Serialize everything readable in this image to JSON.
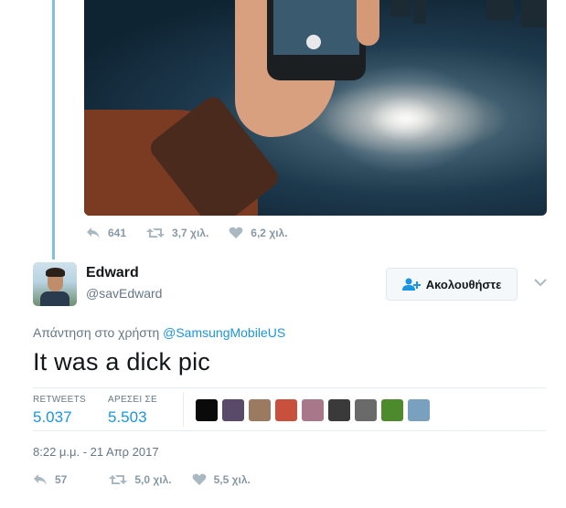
{
  "media": {
    "description_icon": "photo-hand-holding-phone"
  },
  "quoted_actions": {
    "replies": "641",
    "retweets": "3,7 χιλ.",
    "likes": "6,2 χιλ."
  },
  "author": {
    "name": "Edward",
    "handle": "@savEdward"
  },
  "follow_button": {
    "label": "Ακολουθήστε"
  },
  "reply_to": {
    "prefix": "Απάντηση στο χρήστη",
    "mention": "@SamsungMobileUS"
  },
  "tweet": {
    "text": "It was a dick pic"
  },
  "stats": {
    "retweets_label": "RETWEETS",
    "retweets_value": "5.037",
    "likes_label": "ΑΡΕΣΕΙ ΣΕ",
    "likes_value": "5.503",
    "likers": [
      {
        "color": "#0a0a0a"
      },
      {
        "color": "#5a4a6a"
      },
      {
        "color": "#9a7a60"
      },
      {
        "color": "#c8503c"
      },
      {
        "color": "#a8788a"
      },
      {
        "color": "#3a3a3a"
      },
      {
        "color": "#6a6a6a"
      },
      {
        "color": "#4c8a2c"
      },
      {
        "color": "#7aa0c0"
      }
    ]
  },
  "timestamp": "8:22 μ.μ. - 21 Απρ 2017",
  "actions": {
    "replies": "57",
    "retweets": "5,0 χιλ.",
    "likes": "5,5 χιλ."
  },
  "colors": {
    "accent": "#1b95e0",
    "muted": "#8899a6",
    "thread_line": "#80c3d9"
  }
}
